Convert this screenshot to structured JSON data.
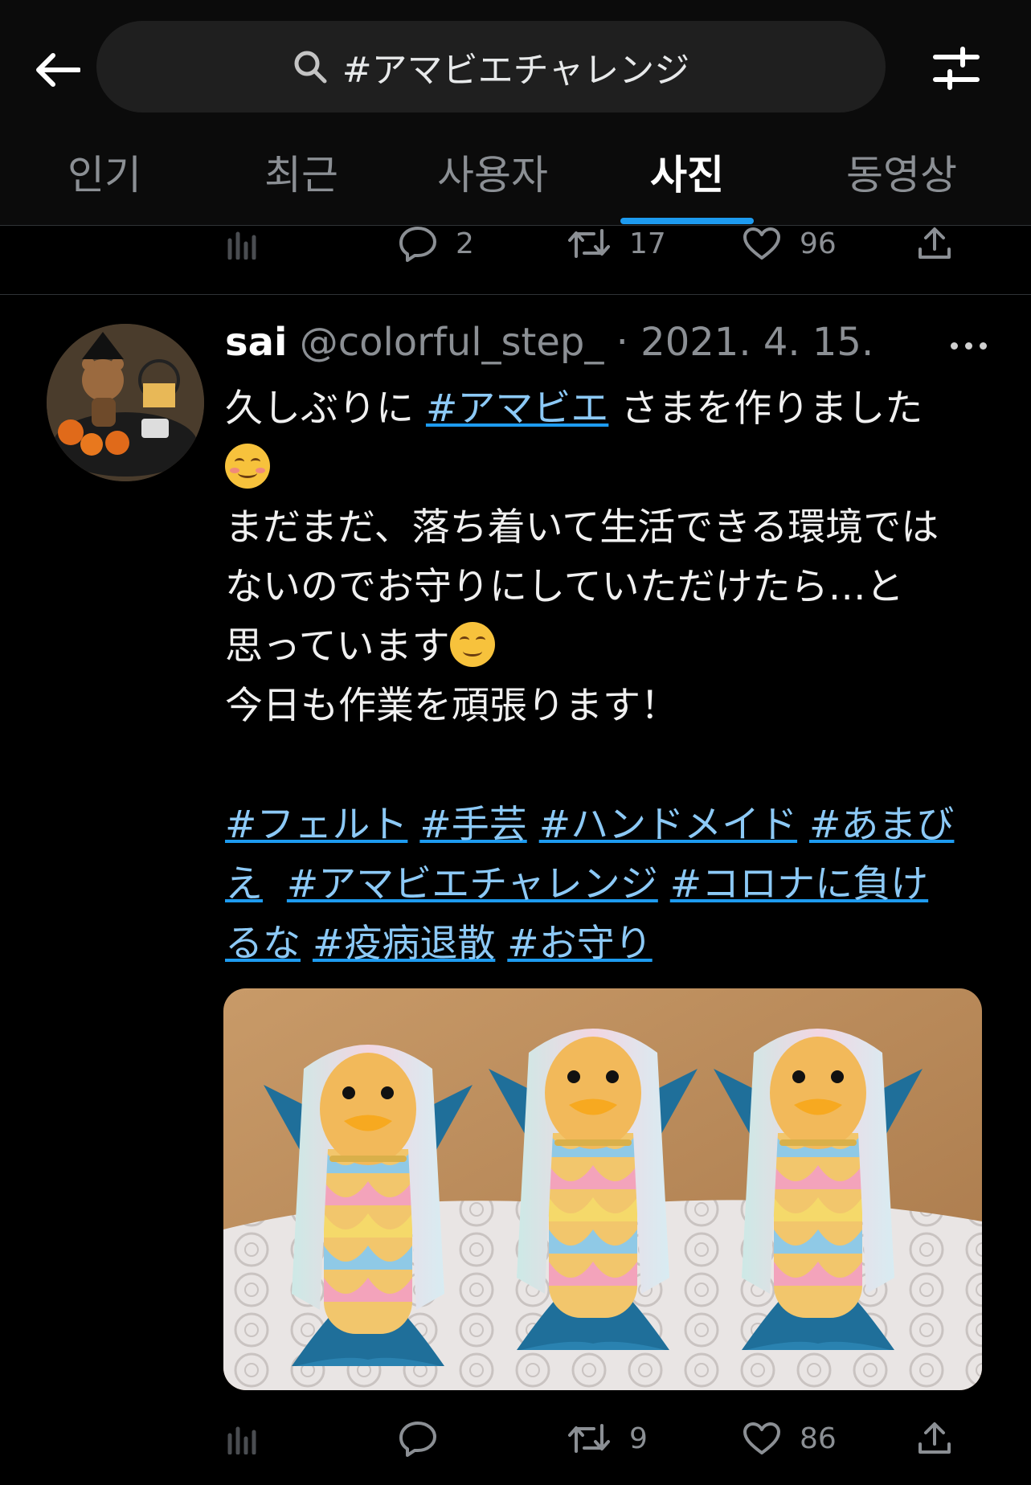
{
  "search": {
    "query": "#アマビエチャレンジ"
  },
  "tabs": [
    {
      "label": "인기"
    },
    {
      "label": "최근"
    },
    {
      "label": "사용자"
    },
    {
      "label": "사진",
      "active": true
    },
    {
      "label": "동영상"
    }
  ],
  "prev_tweet": {
    "replies": "2",
    "retweets": "17",
    "likes": "96"
  },
  "tweet": {
    "name": "sai",
    "handle": "@colorful_step_",
    "date": "· 2021. 4. 15.",
    "line1_text": "久しぶりに ",
    "line1_tag": "#アマビエ",
    "line1_rest": " さまを作りました",
    "line3": "まだまだ、落ち着いて生活できる環境では",
    "line4": "ないのでお守りにしていただけたら…と",
    "line5": "思っています",
    "line6": "今日も作業を頑張ります！",
    "hashtags": [
      "#フェルト",
      "#手芸",
      "#ハンドメイド",
      "#あまび",
      "え",
      "#アマビエチャレンジ",
      "#コロナに負け",
      "るな",
      "#疫病退散",
      "#お守り"
    ],
    "replies": "",
    "retweets": "9",
    "likes": "86"
  },
  "colors": {
    "accent": "#1d9bf0",
    "link": "#8cc9f6",
    "muted": "#8b8f94",
    "background": "#000000"
  }
}
